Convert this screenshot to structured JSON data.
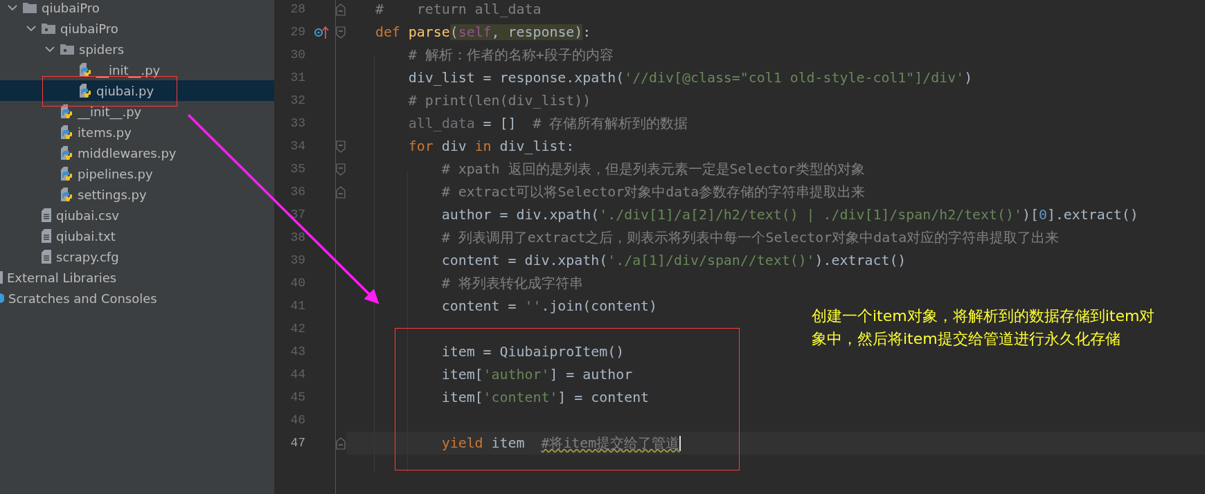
{
  "project_tree": [
    {
      "kind": "folder",
      "label": "qiubaiPro",
      "expanded": true,
      "selected": false,
      "children": [
        {
          "kind": "package",
          "label": "qiubaiPro",
          "expanded": true,
          "selected": false,
          "children": [
            {
              "kind": "package",
              "label": "spiders",
              "expanded": true,
              "selected": false,
              "children": [
                {
                  "kind": "python",
                  "label": "__init__.py",
                  "selected": false
                },
                {
                  "kind": "python",
                  "label": "qiubai.py",
                  "selected": true
                }
              ]
            },
            {
              "kind": "python",
              "label": "__init__.py",
              "selected": false
            },
            {
              "kind": "python",
              "label": "items.py",
              "selected": false
            },
            {
              "kind": "python",
              "label": "middlewares.py",
              "selected": false
            },
            {
              "kind": "python",
              "label": "pipelines.py",
              "selected": false
            },
            {
              "kind": "python",
              "label": "settings.py",
              "selected": false
            }
          ]
        },
        {
          "kind": "text",
          "label": "qiubai.csv",
          "selected": false
        },
        {
          "kind": "text",
          "label": "qiubai.txt",
          "selected": false
        },
        {
          "kind": "text",
          "label": "scrapy.cfg",
          "selected": false
        }
      ]
    },
    {
      "kind": "library",
      "label": "External Libraries",
      "selected": false
    },
    {
      "kind": "scratches",
      "label": "Scratches and Consoles",
      "selected": false
    }
  ],
  "editor": {
    "lines": [
      {
        "number": "28",
        "current": false,
        "gutter": [
          {
            "kind": "fold_end"
          }
        ],
        "tokens": [
          {
            "kind": "comment",
            "text": "    #    return all_data"
          }
        ]
      },
      {
        "number": "29",
        "current": false,
        "gutter": [
          {
            "kind": "override"
          },
          {
            "kind": "fold_start"
          }
        ],
        "tokens": [
          {
            "kind": "keyword",
            "text": "    def "
          },
          {
            "kind": "function",
            "text": "parse"
          },
          {
            "kind": "plain_hl",
            "text": "("
          },
          {
            "kind": "self_hl",
            "text": "self"
          },
          {
            "kind": "plain_hl",
            "text": ", response)"
          },
          {
            "kind": "plain",
            "text": ":"
          }
        ]
      },
      {
        "number": "30",
        "current": false,
        "tokens": [
          {
            "kind": "comment",
            "text": "        # 解析：作者的名称+段子的内容"
          }
        ]
      },
      {
        "number": "31",
        "current": false,
        "tokens": [
          {
            "kind": "plain",
            "text": "        div_list = response.xpath("
          },
          {
            "kind": "string",
            "text": "'//div[@class=\"col1 old-style-col1\"]/div'"
          },
          {
            "kind": "plain",
            "text": ")"
          }
        ]
      },
      {
        "number": "32",
        "current": false,
        "tokens": [
          {
            "kind": "comment",
            "text": "        # print(len(div_list))"
          }
        ]
      },
      {
        "number": "33",
        "current": false,
        "tokens": [
          {
            "kind": "unused",
            "text": "        all_data"
          },
          {
            "kind": "plain",
            "text": " = []  "
          },
          {
            "kind": "comment",
            "text": "# 存储所有解析到的数据"
          }
        ]
      },
      {
        "number": "34",
        "current": false,
        "gutter": [
          {
            "kind": "fold_start"
          }
        ],
        "tokens": [
          {
            "kind": "keyword",
            "text": "        for "
          },
          {
            "kind": "plain",
            "text": "div "
          },
          {
            "kind": "keyword",
            "text": "in "
          },
          {
            "kind": "plain",
            "text": "div_list:"
          }
        ]
      },
      {
        "number": "35",
        "current": false,
        "gutter": [
          {
            "kind": "fold_start"
          }
        ],
        "tokens": [
          {
            "kind": "comment",
            "text": "            # xpath 返回的是列表，但是列表元素一定是Selector类型的对象"
          }
        ]
      },
      {
        "number": "36",
        "current": false,
        "gutter": [
          {
            "kind": "fold_end"
          }
        ],
        "tokens": [
          {
            "kind": "comment",
            "text": "            # extract可以将Selector对象中data参数存储的字符串提取出来"
          }
        ]
      },
      {
        "number": "37",
        "current": false,
        "tokens": [
          {
            "kind": "plain",
            "text": "            author = div.xpath("
          },
          {
            "kind": "string",
            "text": "'./div[1]/a[2]/h2/text() | ./div[1]/span/h2/text()'"
          },
          {
            "kind": "plain",
            "text": ")["
          },
          {
            "kind": "number",
            "text": "0"
          },
          {
            "kind": "plain",
            "text": "].extract()"
          }
        ]
      },
      {
        "number": "38",
        "current": false,
        "tokens": [
          {
            "kind": "comment",
            "text": "            # 列表调用了extract之后，则表示将列表中每一个Selector对象中data对应的字符串提取了出来"
          }
        ]
      },
      {
        "number": "39",
        "current": false,
        "tokens": [
          {
            "kind": "plain",
            "text": "            content = div.xpath("
          },
          {
            "kind": "string",
            "text": "'./a[1]/div/span//text()'"
          },
          {
            "kind": "plain",
            "text": ").extract()"
          }
        ]
      },
      {
        "number": "40",
        "current": false,
        "tokens": [
          {
            "kind": "comment",
            "text": "            # 将列表转化成字符串"
          }
        ]
      },
      {
        "number": "41",
        "current": false,
        "tokens": [
          {
            "kind": "plain",
            "text": "            content = "
          },
          {
            "kind": "string",
            "text": "''"
          },
          {
            "kind": "plain",
            "text": ".join(content)"
          }
        ]
      },
      {
        "number": "42",
        "current": false
      },
      {
        "number": "43",
        "current": false,
        "tokens": [
          {
            "kind": "plain",
            "text": "            item = QiubaiproItem()"
          }
        ]
      },
      {
        "number": "44",
        "current": false,
        "tokens": [
          {
            "kind": "plain",
            "text": "            item["
          },
          {
            "kind": "string",
            "text": "'author'"
          },
          {
            "kind": "plain",
            "text": "] = author"
          }
        ]
      },
      {
        "number": "45",
        "current": false,
        "tokens": [
          {
            "kind": "plain",
            "text": "            item["
          },
          {
            "kind": "string",
            "text": "'content'"
          },
          {
            "kind": "plain",
            "text": "] = content"
          }
        ]
      },
      {
        "number": "46",
        "current": false
      },
      {
        "number": "47",
        "current": true,
        "gutter": [
          {
            "kind": "fold_end"
          }
        ],
        "tokens": [
          {
            "kind": "keyword",
            "text": "            yield "
          },
          {
            "kind": "plain",
            "text": "item  "
          },
          {
            "kind": "comment_typo",
            "text": "#将item提交给了管道"
          }
        ]
      }
    ]
  },
  "annotation": {
    "text": "创建一个item对象，将解析到的数据存储到item对象中，然后将item提交给管道进行永久化存储"
  }
}
